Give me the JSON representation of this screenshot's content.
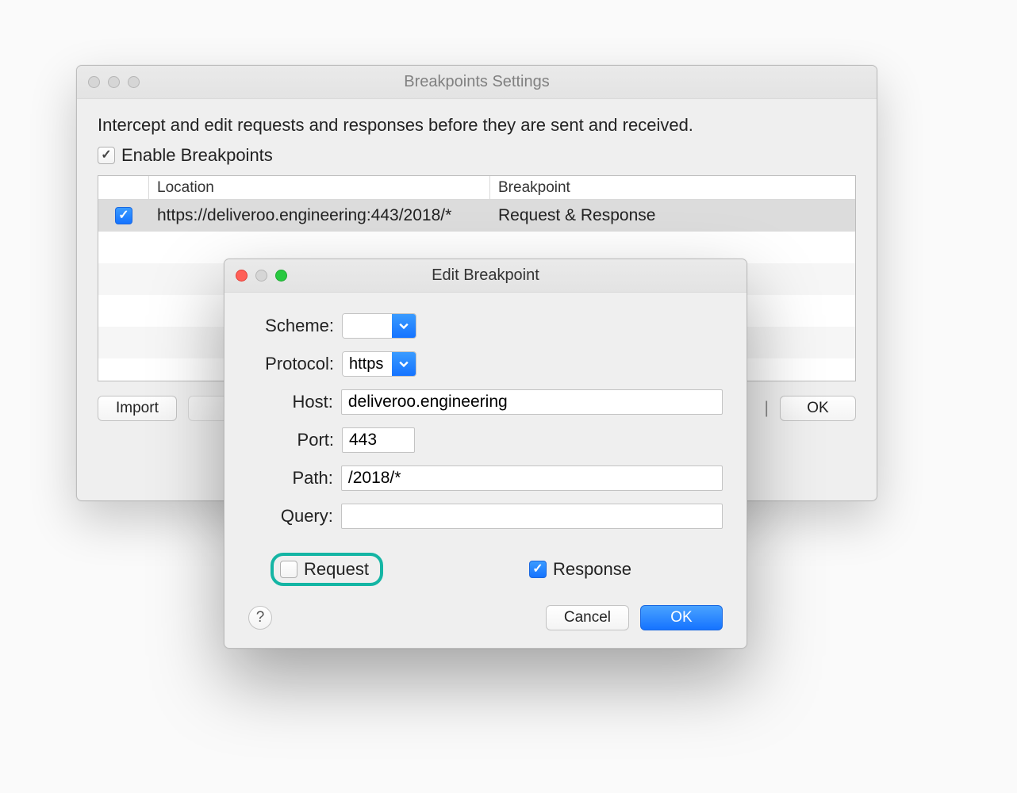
{
  "bg_window": {
    "title": "Breakpoints Settings",
    "intro": "Intercept and edit requests and responses before they are sent and received.",
    "enable_label": "Enable Breakpoints",
    "columns": {
      "location": "Location",
      "breakpoint": "Breakpoint"
    },
    "rows": [
      {
        "location": "https://deliveroo.engineering:443/2018/*",
        "breakpoint": "Request & Response"
      }
    ],
    "buttons": {
      "import": "Import",
      "ok": "OK"
    }
  },
  "fg_window": {
    "title": "Edit Breakpoint",
    "labels": {
      "scheme": "Scheme:",
      "protocol": "Protocol:",
      "host": "Host:",
      "port": "Port:",
      "path": "Path:",
      "query": "Query:"
    },
    "values": {
      "scheme": "",
      "protocol": "https",
      "host": "deliveroo.engineering",
      "port": "443",
      "path": "/2018/*",
      "query": ""
    },
    "request_label": "Request",
    "response_label": "Response",
    "help": "?",
    "cancel": "Cancel",
    "ok": "OK"
  }
}
